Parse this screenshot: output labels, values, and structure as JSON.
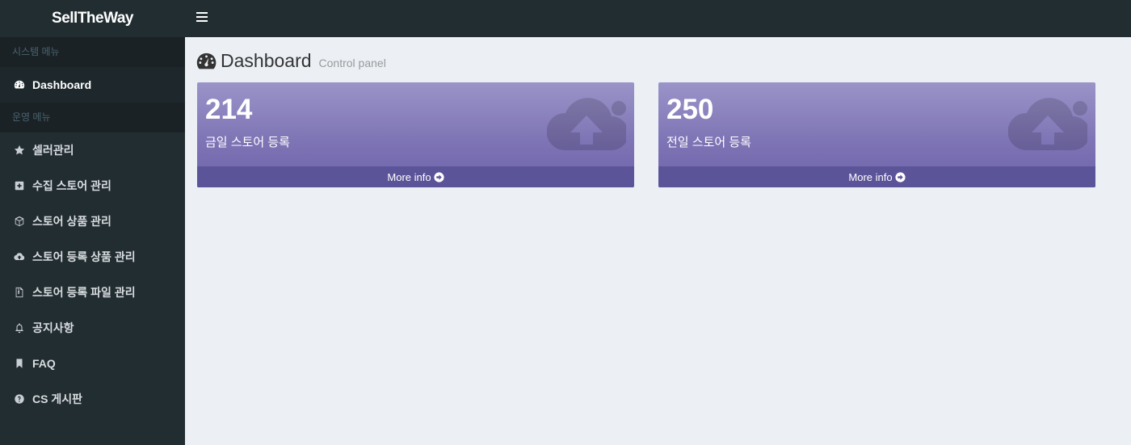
{
  "app": {
    "title": "SellTheWay"
  },
  "sidebar": {
    "section1": "시스템 메뉴",
    "dashboard": "Dashboard",
    "section2": "운영 메뉴",
    "items": [
      {
        "label": "셀러관리",
        "icon": "star-icon"
      },
      {
        "label": "수집 스토어 관리",
        "icon": "plus-square-icon"
      },
      {
        "label": "스토어 상품 관리",
        "icon": "cube-icon"
      },
      {
        "label": "스토어 등록 상품 관리",
        "icon": "cloud-upload-icon"
      },
      {
        "label": "스토어 등록 파일 관리",
        "icon": "file-zip-icon"
      },
      {
        "label": "공지사항",
        "icon": "bell-icon"
      },
      {
        "label": "FAQ",
        "icon": "bookmark-icon"
      },
      {
        "label": "CS 게시판",
        "icon": "question-circle-icon"
      }
    ]
  },
  "header": {
    "title": "Dashboard",
    "subtitle": "Control panel"
  },
  "boxes": [
    {
      "value": "214",
      "label": "금일 스토어 등록",
      "more": "More info"
    },
    {
      "value": "250",
      "label": "전일 스토어 등록",
      "more": "More info"
    }
  ],
  "colors": {
    "sidebar": "#222d32",
    "box": "#7c72b4",
    "box_footer": "#5c5499",
    "background": "#ecf0f5"
  }
}
